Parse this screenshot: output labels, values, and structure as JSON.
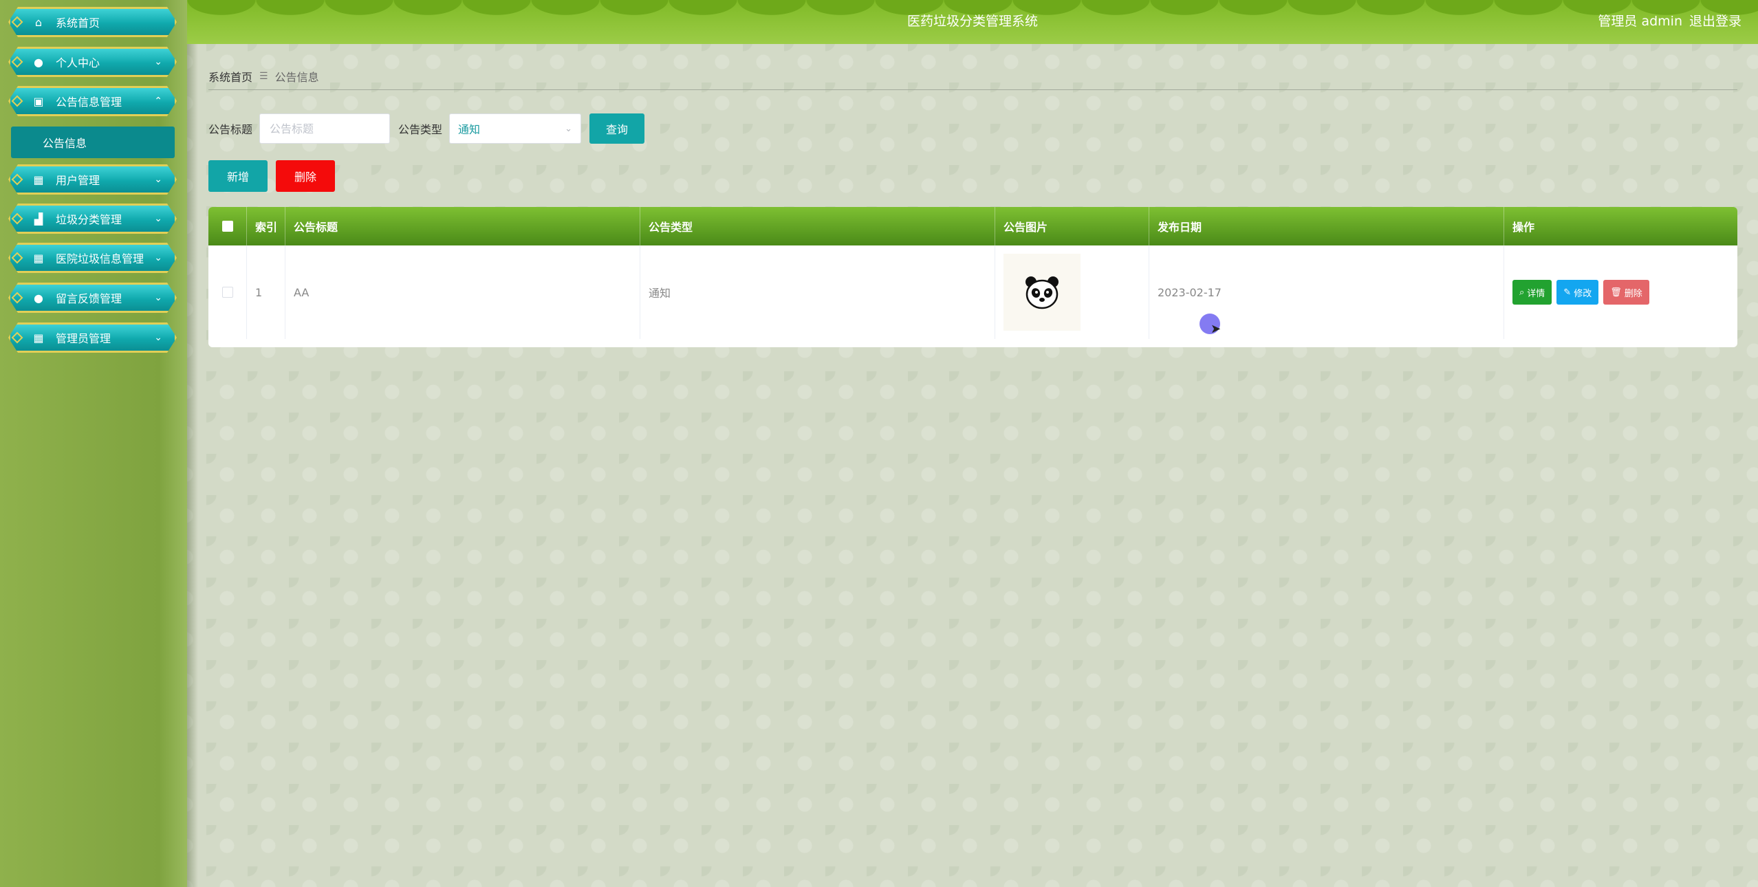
{
  "header": {
    "title": "医药垃圾分类管理系统",
    "user_label": "管理员 admin",
    "logout": "退出登录"
  },
  "sidebar": {
    "items": [
      {
        "label": "系统首页",
        "icon": "home-icon",
        "glyph": "⌂"
      },
      {
        "label": "个人中心",
        "icon": "user-icon",
        "glyph": "●"
      },
      {
        "label": "公告信息管理",
        "icon": "briefcase-icon",
        "glyph": "▣"
      },
      {
        "label": "用户管理",
        "icon": "grid-icon",
        "glyph": "▦"
      },
      {
        "label": "垃圾分类管理",
        "icon": "truck-icon",
        "glyph": "▟"
      },
      {
        "label": "医院垃圾信息管理",
        "icon": "grid-icon",
        "glyph": "▦"
      },
      {
        "label": "留言反馈管理",
        "icon": "user-icon",
        "glyph": "●"
      },
      {
        "label": "管理员管理",
        "icon": "grid-icon",
        "glyph": "▦"
      }
    ],
    "sub_item": "公告信息"
  },
  "breadcrumb": {
    "home": "系统首页",
    "separator": "☰",
    "current": "公告信息"
  },
  "search": {
    "title_label": "公告标题",
    "title_placeholder": "公告标题",
    "type_label": "公告类型",
    "type_value": "通知",
    "query_button": "查询"
  },
  "actions": {
    "add": "新增",
    "delete": "删除"
  },
  "table": {
    "headers": [
      "索引",
      "公告标题",
      "公告类型",
      "公告图片",
      "发布日期",
      "操作"
    ],
    "rows": [
      {
        "index": "1",
        "title": "AA",
        "type": "通知",
        "image_icon": "panda-icon",
        "date": "2023-02-17"
      }
    ],
    "row_actions": {
      "detail": "详情",
      "edit": "修改",
      "delete": "删除"
    }
  },
  "colors": {
    "accent": "#12a5a7",
    "header_green": "#7fba26",
    "danger": "#f40b0b"
  }
}
